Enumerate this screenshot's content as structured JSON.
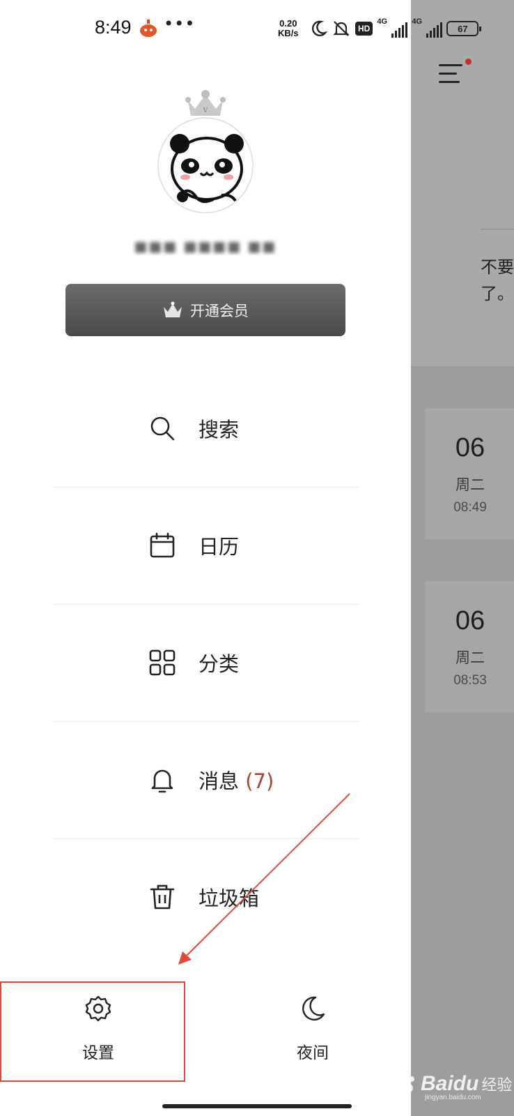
{
  "status_bar": {
    "time": "8:49",
    "more": "•••",
    "net_speed_value": "0.20",
    "net_speed_unit": "KB/s",
    "hd": "HD",
    "signal1_label": "4G",
    "signal2_label": "4G",
    "battery": "67"
  },
  "drawer": {
    "username": "■■■ ■■■■ ■■",
    "vip_button_label": "开通会员",
    "menu": [
      {
        "label": "搜索",
        "icon": "search-icon"
      },
      {
        "label": "日历",
        "icon": "calendar-icon"
      },
      {
        "label": "分类",
        "icon": "grid-icon"
      },
      {
        "label": "消息",
        "count": "(7)",
        "icon": "bell-icon"
      },
      {
        "label": "垃圾箱",
        "icon": "trash-icon"
      }
    ],
    "bottom": {
      "settings_label": "设置",
      "night_label": "夜间"
    }
  },
  "background_app": {
    "snippet_line1": "不要",
    "snippet_line2": "了。",
    "cards": [
      {
        "day": "06",
        "weekday": "周二",
        "time": "08:49"
      },
      {
        "day": "06",
        "weekday": "周二",
        "time": "08:53"
      }
    ]
  },
  "watermark": {
    "brand": "Baidu",
    "suffix": "经验",
    "url": "jingyan.baidu.com"
  },
  "colors": {
    "accent_red": "#a9442f",
    "highlight_red": "#e04a3a",
    "vip_button": "#555555"
  }
}
